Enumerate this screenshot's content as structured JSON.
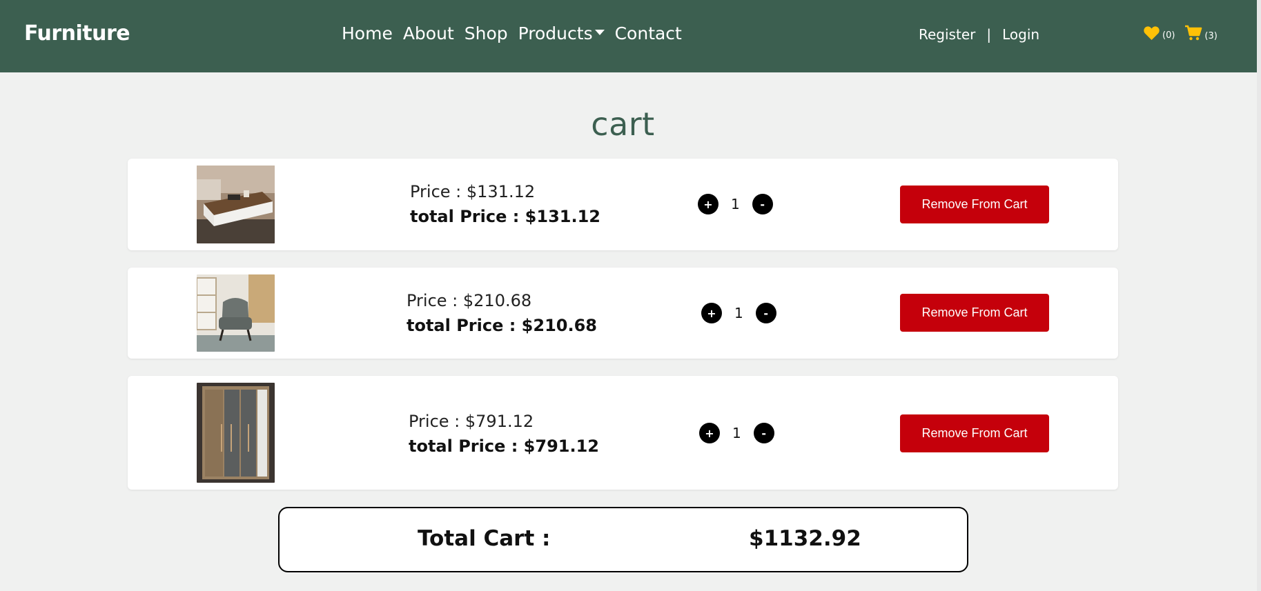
{
  "navbar": {
    "brand": "Furniture",
    "links": [
      "Home",
      "About",
      "Shop",
      "Products",
      "Contact"
    ],
    "register": "Register",
    "separator": "|",
    "login": "Login",
    "wishlist_count": "(0)",
    "cart_count": "(3)",
    "icon_color": "#ffc107",
    "background": "#3c5f50"
  },
  "page": {
    "title": "cart"
  },
  "cart": {
    "items": [
      {
        "price_label": "Price : $131.12",
        "total_label": "total Price : $131.12",
        "quantity": "1",
        "plus": "+",
        "minus": "-",
        "remove": "Remove From Cart"
      },
      {
        "price_label": "Price : $210.68",
        "total_label": "total Price : $210.68",
        "quantity": "1",
        "plus": "+",
        "minus": "-",
        "remove": "Remove From Cart"
      },
      {
        "price_label": "Price : $791.12",
        "total_label": "total Price : $791.12",
        "quantity": "1",
        "plus": "+",
        "minus": "-",
        "remove": "Remove From Cart"
      }
    ],
    "total_label": "Total Cart :",
    "total_value": "$1132.92"
  }
}
